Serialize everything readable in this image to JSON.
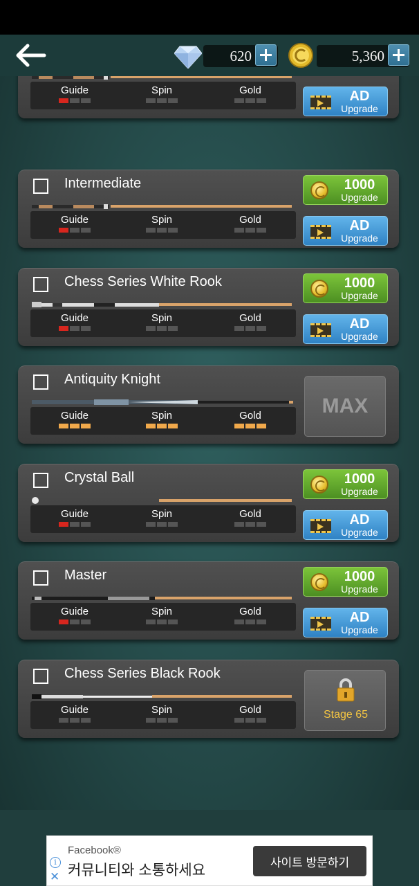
{
  "header": {
    "diamonds": "620",
    "coins": "5,360"
  },
  "stat_labels": [
    "Guide",
    "Spin",
    "Gold"
  ],
  "cues": [
    {
      "name": "",
      "levels": [
        1,
        0,
        0
      ],
      "action": "upgrade",
      "gold_price": "1000",
      "gold_sub": "Upgrade",
      "ad_label": "AD",
      "ad_sub": "Upgrade"
    },
    {
      "name": "Intermediate",
      "levels": [
        1,
        0,
        0
      ],
      "action": "upgrade",
      "gold_price": "1000",
      "gold_sub": "Upgrade",
      "ad_label": "AD",
      "ad_sub": "Upgrade"
    },
    {
      "name": "Chess Series White Rook",
      "levels": [
        1,
        0,
        0
      ],
      "action": "upgrade",
      "gold_price": "1000",
      "gold_sub": "Upgrade",
      "ad_label": "AD",
      "ad_sub": "Upgrade"
    },
    {
      "name": "Antiquity Knight",
      "levels": [
        3,
        3,
        3
      ],
      "action": "max",
      "max_label": "MAX"
    },
    {
      "name": "Crystal Ball",
      "levels": [
        1,
        0,
        0
      ],
      "action": "upgrade",
      "gold_price": "1000",
      "gold_sub": "Upgrade",
      "ad_label": "AD",
      "ad_sub": "Upgrade"
    },
    {
      "name": "Master",
      "levels": [
        1,
        0,
        0
      ],
      "action": "upgrade",
      "gold_price": "1000",
      "gold_sub": "Upgrade",
      "ad_label": "AD",
      "ad_sub": "Upgrade"
    },
    {
      "name": "Chess Series Black Rook",
      "levels": [
        0,
        0,
        0
      ],
      "action": "locked",
      "lock_label": "Stage 65"
    }
  ],
  "ad": {
    "brand": "Facebook®",
    "text": "커뮤니티와 소통하세요",
    "button": "사이트 방문하기"
  },
  "colors": {
    "level_on_low": "#d7261e",
    "level_on_max": "#f1a94b",
    "level_off": "#555555",
    "gold_button": "#5ea82c",
    "ad_button": "#3f95d6"
  }
}
